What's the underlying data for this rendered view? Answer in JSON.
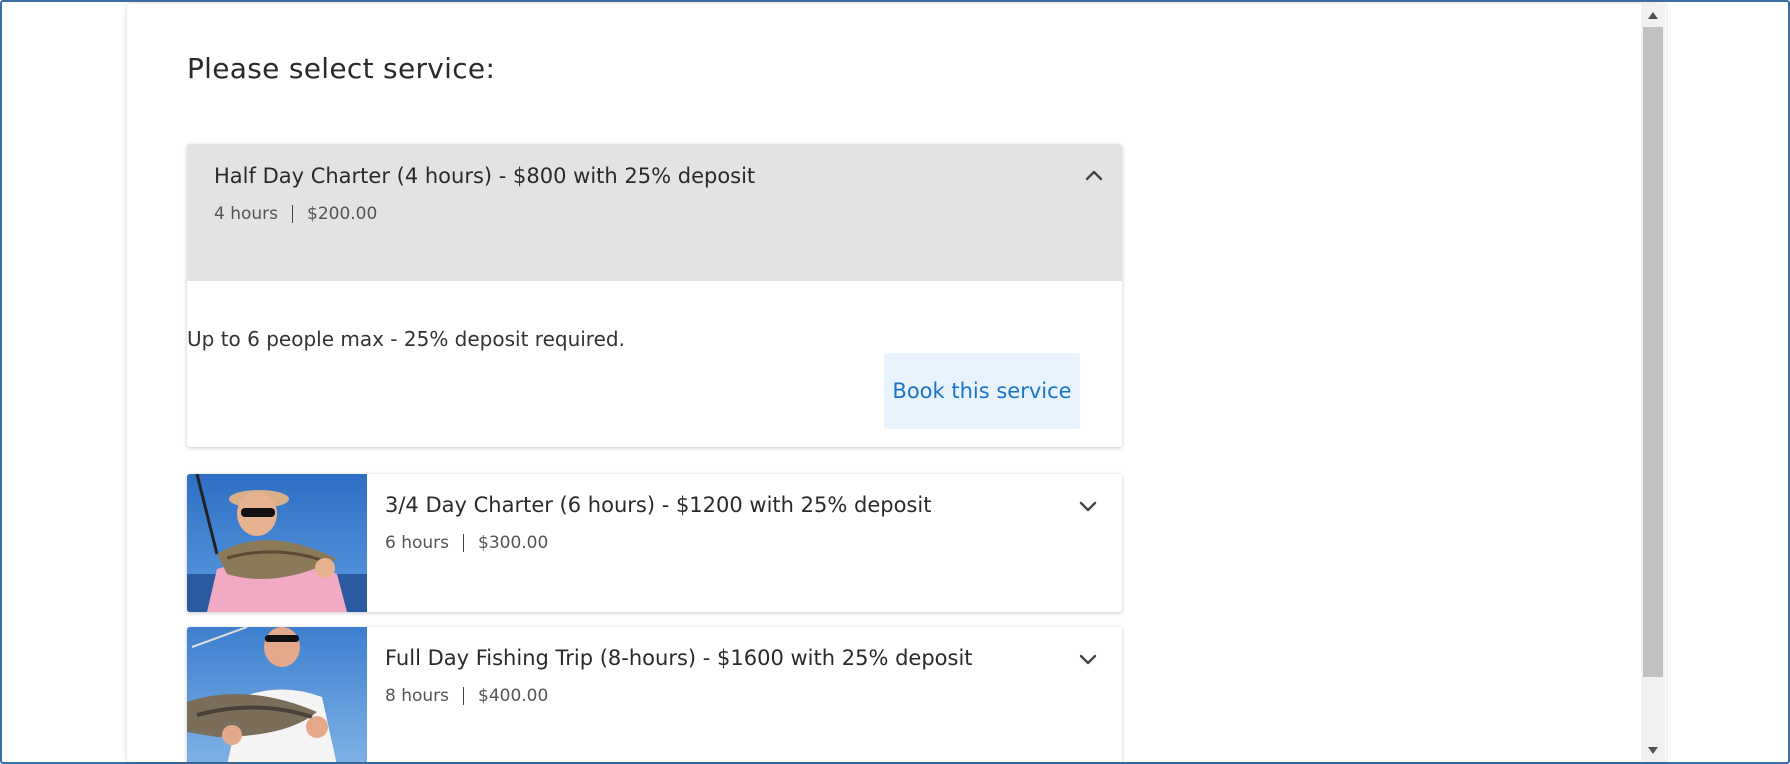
{
  "page": {
    "title": "Please select service:"
  },
  "services": [
    {
      "title": "Half Day Charter (4 hours) - $800 with 25% deposit",
      "duration": "4 hours",
      "price": "$200.00",
      "expanded": true,
      "description": "Up to 6 people max - 25% deposit required.",
      "book_label": "Book this service",
      "toggle_icon": "chevron-up-icon"
    },
    {
      "title": "3/4 Day Charter (6 hours) - $1200 with 25% deposit",
      "duration": "6 hours",
      "price": "$300.00",
      "expanded": false,
      "image": "woman-holding-fish-photo",
      "toggle_icon": "chevron-down-icon"
    },
    {
      "title": "Full Day Fishing Trip (8-hours) - $1600 with 25% deposit",
      "duration": "8 hours",
      "price": "$400.00",
      "expanded": false,
      "image": "man-holding-fish-photo",
      "toggle_icon": "chevron-down-icon"
    }
  ],
  "colors": {
    "accent": "#1a73c8",
    "button_bg": "#e8f3fd",
    "expanded_header_bg": "#e3e3e3",
    "frame_border": "#3a6ea5"
  }
}
